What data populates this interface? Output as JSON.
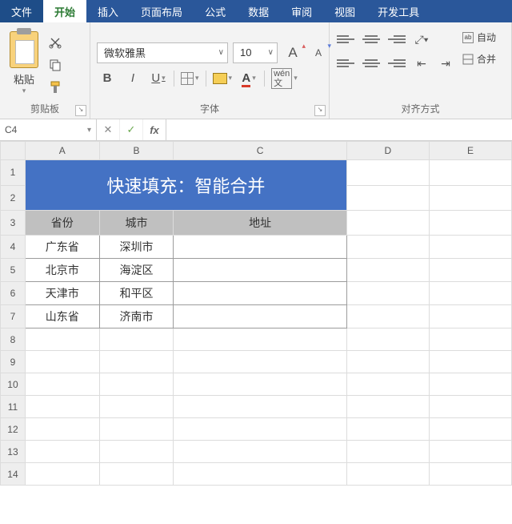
{
  "tabs": {
    "file": "文件",
    "home": "开始",
    "insert": "插入",
    "page_layout": "页面布局",
    "formulas": "公式",
    "data": "数据",
    "review": "审阅",
    "view": "视图",
    "developer": "开发工具"
  },
  "ribbon": {
    "clipboard": {
      "paste": "粘贴",
      "label": "剪贴板"
    },
    "font": {
      "name": "微软雅黑",
      "size": "10",
      "grow": "A",
      "shrink": "A",
      "bold": "B",
      "italic": "I",
      "underline": "U",
      "color_letter": "A",
      "phonetic": "wén",
      "cn": "文",
      "label": "字体"
    },
    "align": {
      "wrap_prefix": "ab",
      "wrap": "自动",
      "merge": "合并",
      "label": "对齐方式"
    }
  },
  "formula_bar": {
    "name_box": "C4",
    "cancel": "✕",
    "enter": "✓",
    "fx": "fx",
    "value": ""
  },
  "columns": [
    "A",
    "B",
    "C",
    "D",
    "E"
  ],
  "title": "快速填充：智能合并",
  "headers": {
    "prov": "省份",
    "city": "城市",
    "addr": "地址"
  },
  "rows": [
    {
      "n": "4",
      "prov": "广东省",
      "city": "深圳市",
      "addr": ""
    },
    {
      "n": "5",
      "prov": "北京市",
      "city": "海淀区",
      "addr": ""
    },
    {
      "n": "6",
      "prov": "天津市",
      "city": "和平区",
      "addr": ""
    },
    {
      "n": "7",
      "prov": "山东省",
      "city": "济南市",
      "addr": ""
    }
  ],
  "blank_rows": [
    "8",
    "9",
    "10",
    "11",
    "12",
    "13",
    "14"
  ]
}
